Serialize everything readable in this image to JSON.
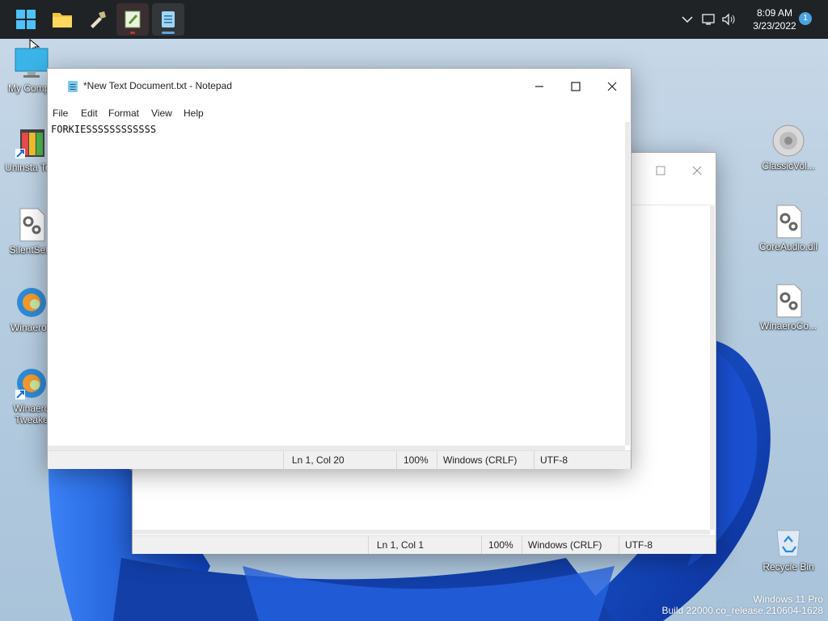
{
  "taskbar": {
    "apps": [
      {
        "name": "start-button",
        "icon": "windows-logo-icon"
      },
      {
        "name": "file-explorer",
        "icon": "folder-icon"
      },
      {
        "name": "uninstall-tool",
        "icon": "wrench-icon"
      },
      {
        "name": "notepad-modified",
        "icon": "notepad-icon"
      },
      {
        "name": "notepad",
        "icon": "notepad-icon"
      }
    ],
    "clock_time": "8:09 AM",
    "clock_date": "3/23/2022",
    "notification_count": "1"
  },
  "desktop_left": [
    {
      "label": "My Compu",
      "icon": "monitor-icon"
    },
    {
      "label": "Uninsta Tool",
      "icon": "uninstall-tool-icon"
    },
    {
      "label": "SilentSetu",
      "icon": "settings-file-icon"
    },
    {
      "label": "WinaeroT",
      "icon": "edge-icon"
    },
    {
      "label": "Winaero Tweake",
      "icon": "edge-icon"
    }
  ],
  "desktop_right": [
    {
      "label": "ClassicVol...",
      "icon": "speaker-icon"
    },
    {
      "label": "CoreAudio.dll",
      "icon": "settings-file-icon"
    },
    {
      "label": "WinaeroCo...",
      "icon": "settings-file-icon"
    },
    {
      "label": "Recycle Bin",
      "icon": "recycle-bin-icon"
    }
  ],
  "notepad_front": {
    "title": "*New Text Document.txt - Notepad",
    "menu": [
      "File",
      "Edit",
      "Format",
      "View",
      "Help"
    ],
    "content": "FORKIESSSSSSSSSSSS",
    "status": {
      "position": "Ln 1, Col 20",
      "zoom": "100%",
      "line_ending": "Windows (CRLF)",
      "encoding": "UTF-8"
    }
  },
  "notepad_back": {
    "status": {
      "position": "Ln 1, Col 1",
      "zoom": "100%",
      "line_ending": "Windows (CRLF)",
      "encoding": "UTF-8"
    }
  },
  "watermark": {
    "line1": "Windows 11 Pro",
    "line2": "Build 22000.co_release.210604-1628"
  }
}
